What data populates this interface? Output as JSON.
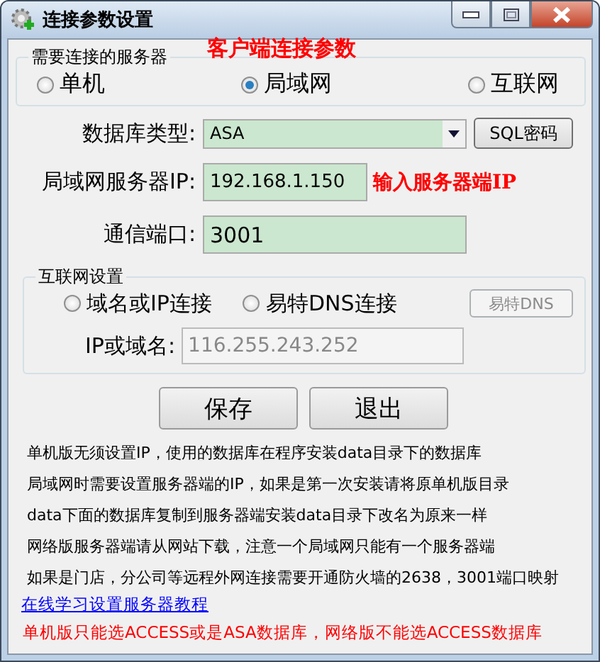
{
  "window": {
    "title": "连接参数设置"
  },
  "annotation": "客户端连接参数",
  "server_group": {
    "title": "需要连接的服务器",
    "options": [
      {
        "label": "单机",
        "selected": false
      },
      {
        "label": "局域网",
        "selected": true
      },
      {
        "label": "互联网",
        "selected": false
      }
    ]
  },
  "db_type": {
    "label": "数据库类型:",
    "value": "ASA"
  },
  "sql_button": "SQL密码",
  "lan_ip": {
    "label": "局域网服务器IP:",
    "value": "192.168.1.150",
    "hint": "输入服务器端IP"
  },
  "port": {
    "label": "通信端口:",
    "value": "3001"
  },
  "internet_group": {
    "title": "互联网设置",
    "options": [
      {
        "label": "域名或IP连接",
        "selected": false
      },
      {
        "label": "易特DNS连接",
        "selected": false
      }
    ],
    "dns_button": {
      "label": "易特DNS",
      "disabled": true
    },
    "host": {
      "label": "IP或域名:",
      "value": "116.255.243.252",
      "disabled": true
    }
  },
  "buttons": [
    "保存",
    "退出"
  ],
  "notes": [
    "单机版无须设置IP，使用的数据库在程序安装data目录下的数据库",
    "局域网时需要设置服务器端的IP，如果是第一次安装请将原单机版目录",
    "data下面的数据库复制到服务器端安装data目录下改名为原来一样",
    "网络版服务器端请从网站下载，注意一个局域网只能有一个服务器端",
    "如果是门店，分公司等远程外网连接需要开通防火墙的2638，3001端口映射"
  ],
  "link": "在线学习设置服务器教程",
  "warning": "单机版只能选ACCESS或是ASA数据库，网络版不能选ACCESS数据库"
}
